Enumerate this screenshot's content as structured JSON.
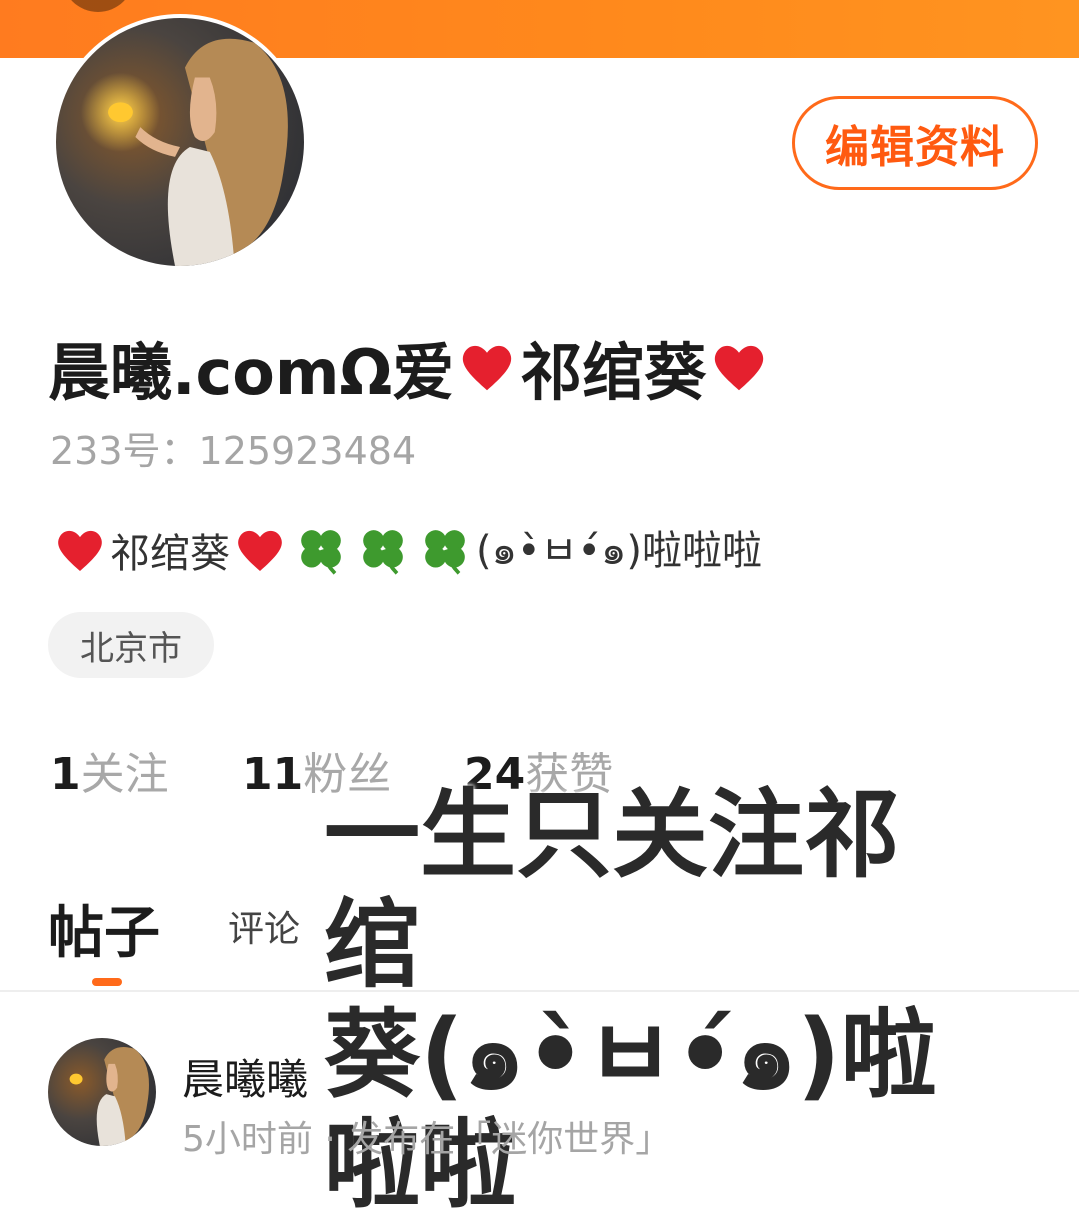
{
  "header": {
    "color": "#ff8a1c"
  },
  "profile": {
    "username_parts": [
      "晨曦.comΩ爱",
      "祁绾葵"
    ],
    "id_text": "233号：125923484",
    "bio_parts": [
      "祁绾葵",
      "(๑•̀ㅂ•́๑)啦啦啦"
    ],
    "location": "北京市",
    "edit_button": "编辑资料",
    "accent_color": "#ff6a1a"
  },
  "stats": [
    {
      "num": "1",
      "label": "关注"
    },
    {
      "num": "11",
      "label": "粉丝"
    },
    {
      "num": "24",
      "label": "获赞"
    }
  ],
  "overlay": {
    "line1": "一生只关注祁绾",
    "line2": "葵(๑•̀ㅂ•́๑)啦啦啦"
  },
  "tabs": {
    "posts": "帖子",
    "comments": "评论"
  },
  "post": {
    "author": "晨曦曦",
    "meta": "5小时前 · 发布在「迷你世界」"
  },
  "icons": {
    "heart": "heart-icon",
    "clover": "clover-icon"
  }
}
